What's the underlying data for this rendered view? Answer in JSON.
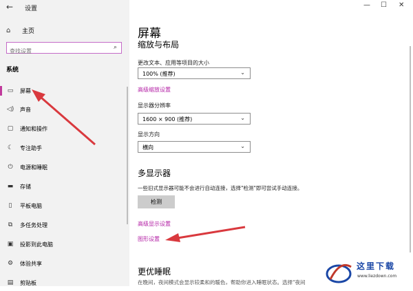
{
  "titlebar": {
    "back": "←",
    "title": "设置",
    "minimize": "—",
    "maximize": "☐",
    "close": "✕"
  },
  "sidebar": {
    "home": {
      "icon": "home-icon",
      "label": "主页"
    },
    "search_placeholder": "查找设置",
    "section": "系统",
    "items": [
      {
        "icon": "monitor-icon",
        "label": "屏幕",
        "active": true
      },
      {
        "icon": "speaker-icon",
        "label": "声音"
      },
      {
        "icon": "notification-icon",
        "label": "通知和操作"
      },
      {
        "icon": "moon-icon",
        "label": "专注助手"
      },
      {
        "icon": "power-icon",
        "label": "电源和睡眠"
      },
      {
        "icon": "storage-icon",
        "label": "存储"
      },
      {
        "icon": "tablet-icon",
        "label": "平板电脑"
      },
      {
        "icon": "multitask-icon",
        "label": "多任务处理"
      },
      {
        "icon": "project-icon",
        "label": "投影到此电脑"
      },
      {
        "icon": "experience-icon",
        "label": "体验共享"
      },
      {
        "icon": "clipboard-icon",
        "label": "剪贴板"
      }
    ]
  },
  "main": {
    "page_title": "屏幕",
    "scale_heading": "缩放与布局",
    "text_size_label": "更改文本、应用等项目的大小",
    "text_size_value": "100% (推荐)",
    "advanced_scale_link": "高级缩放设置",
    "resolution_label": "显示器分辨率",
    "resolution_value": "1600 × 900 (推荐)",
    "orientation_label": "显示方向",
    "orientation_value": "横向",
    "multi_heading": "多显示器",
    "multi_desc": "一些旧式显示器可能不会进行自动连接，选择\"检测\"即可尝试手动连接。",
    "detect_button": "检测",
    "advanced_display_link": "高级显示设置",
    "graphics_link": "图形设置",
    "sleep_heading": "更优睡眠",
    "sleep_desc": "在晚间，夜间模式会显示较柔和的暖色，帮助你进入睡眠状态。选择\"夜间"
  },
  "watermark": {
    "text": "这里下载",
    "url": "www.liezdown.com"
  },
  "colors": {
    "accent": "#b423a6",
    "arrow": "#d9393e",
    "sidebar_bg": "#f2f2f2"
  }
}
